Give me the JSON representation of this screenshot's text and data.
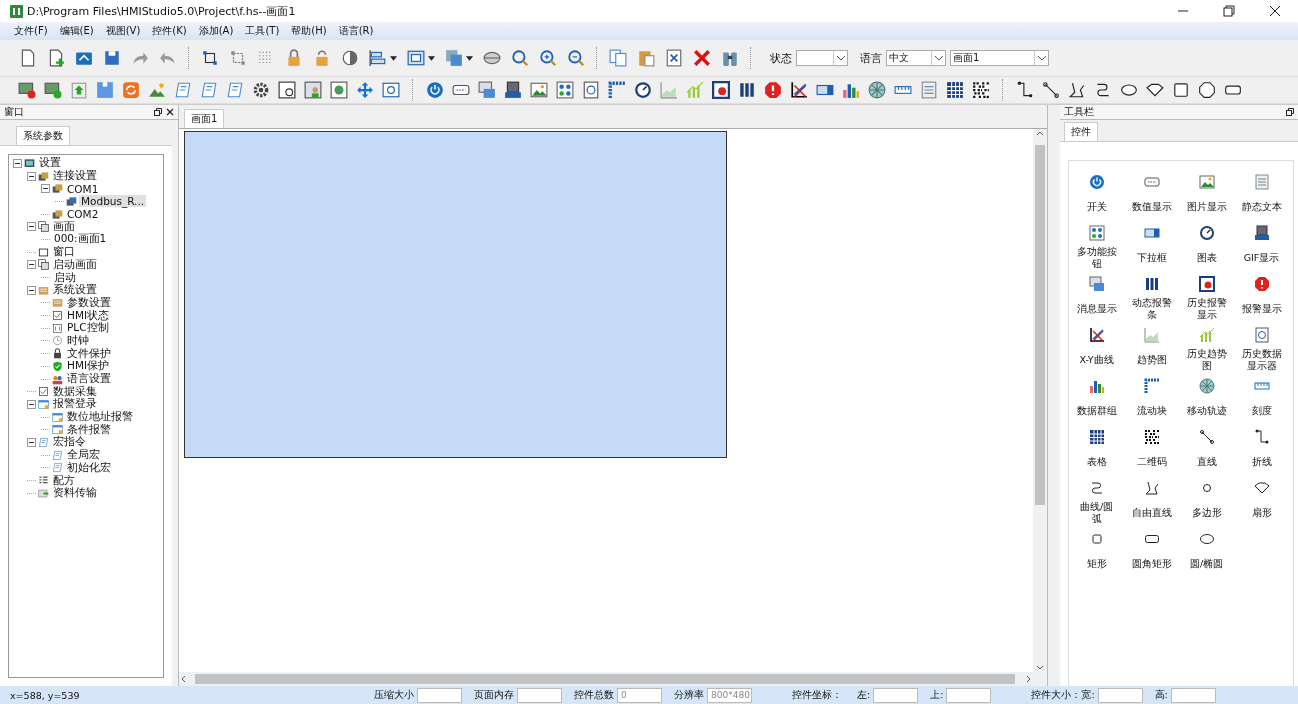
{
  "window": {
    "title": "D:\\Program Files\\HMIStudio5.0\\Project\\f.hs--画面1"
  },
  "menu": [
    {
      "label": "文件(F)"
    },
    {
      "label": "编辑(E)"
    },
    {
      "label": "视图(V)"
    },
    {
      "label": "控件(K)"
    },
    {
      "label": "添加(A)"
    },
    {
      "label": "工具(T)"
    },
    {
      "label": "帮助(H)"
    },
    {
      "label": "语言(R)"
    }
  ],
  "toolbar": {
    "fields": [
      {
        "label": "状态",
        "kind": "combo"
      },
      {
        "label": "语言",
        "kind": "combo",
        "value": "中文"
      },
      {
        "kind": "combo",
        "value": "画面1"
      }
    ]
  },
  "left_panel": {
    "title": "窗口",
    "tabs": [
      {
        "label": "系统参数",
        "selected": true
      }
    ],
    "tree": [
      {
        "label": "设置",
        "kind": "node",
        "expanded": true,
        "selected": false,
        "children": [
          {
            "label": "连接设置",
            "kind": "node",
            "expanded": true,
            "selected": false,
            "children": [
              {
                "label": "COM1",
                "kind": "node",
                "expanded": true,
                "selected": false,
                "children": [
                  {
                    "label": "Modbus_R...",
                    "kind": "node",
                    "selected": true
                  }
                ]
              },
              {
                "label": "COM2",
                "kind": "node",
                "selected": false
              }
            ]
          },
          {
            "label": "画面",
            "kind": "node",
            "expanded": true,
            "selected": false,
            "children": [
              {
                "label": "000:画面1",
                "kind": "text",
                "selected": false
              }
            ]
          },
          {
            "label": "窗口",
            "kind": "node",
            "selected": false
          },
          {
            "label": "启动画面",
            "kind": "node",
            "expanded": true,
            "selected": false,
            "children": [
              {
                "label": "启动",
                "kind": "text",
                "selected": false
              }
            ]
          },
          {
            "label": "系统设置",
            "kind": "node",
            "expanded": true,
            "selected": false,
            "children": [
              {
                "label": "参数设置",
                "kind": "node",
                "selected": false
              },
              {
                "label": "HMI状态",
                "kind": "node",
                "selected": false
              },
              {
                "label": "PLC控制",
                "kind": "node",
                "selected": false
              },
              {
                "label": "时钟",
                "kind": "node",
                "selected": false
              },
              {
                "label": "文件保护",
                "kind": "node",
                "selected": false
              },
              {
                "label": "HMI保护",
                "kind": "node",
                "selected": false
              },
              {
                "label": "语言设置",
                "kind": "node",
                "selected": false
              }
            ]
          },
          {
            "label": "数据采集",
            "kind": "node",
            "selected": false
          },
          {
            "label": "报警登录",
            "kind": "node",
            "expanded": true,
            "selected": false,
            "children": [
              {
                "label": "数位地址报警",
                "kind": "node",
                "selected": false
              },
              {
                "label": "条件报警",
                "kind": "node",
                "selected": false
              }
            ]
          },
          {
            "label": "宏指令",
            "kind": "node",
            "expanded": true,
            "selected": false,
            "children": [
              {
                "label": "全局宏",
                "kind": "node",
                "selected": false
              },
              {
                "label": "初始化宏",
                "kind": "node",
                "selected": false
              }
            ]
          },
          {
            "label": "配方",
            "kind": "node",
            "selected": false
          },
          {
            "label": "资料传输",
            "kind": "node",
            "selected": false
          }
        ]
      }
    ]
  },
  "editor": {
    "tabs": [
      {
        "label": "画面1",
        "selected": true
      }
    ]
  },
  "right_panel": {
    "title": "工具栏",
    "tabs": [
      {
        "label": "控件",
        "selected": true
      }
    ],
    "controls": [
      {
        "label": "开关"
      },
      {
        "label": "数值显示"
      },
      {
        "label": "图片显示"
      },
      {
        "label": "静态文本"
      },
      {
        "label": "多功能按钮"
      },
      {
        "label": "下拉框"
      },
      {
        "label": "图表"
      },
      {
        "label": "GIF显示"
      },
      {
        "label": "消息显示"
      },
      {
        "label": "动态报警条"
      },
      {
        "label": "历史报警显示"
      },
      {
        "label": "报警显示"
      },
      {
        "label": "X-Y曲线"
      },
      {
        "label": "趋势图"
      },
      {
        "label": "历史趋势图"
      },
      {
        "label": "历史数据显示器"
      },
      {
        "label": "数据群组"
      },
      {
        "label": "流动块"
      },
      {
        "label": "移动轨迹"
      },
      {
        "label": "刻度"
      },
      {
        "label": "表格"
      },
      {
        "label": "二维码"
      },
      {
        "label": "直线"
      },
      {
        "label": "折线"
      },
      {
        "label": "曲线/圆弧"
      },
      {
        "label": "自由直线"
      },
      {
        "label": "多边形"
      },
      {
        "label": "扇形"
      },
      {
        "label": "矩形"
      },
      {
        "label": "圆角矩形"
      },
      {
        "label": "圆/椭圆"
      }
    ]
  },
  "status_bar": {
    "cursor": "x=588, y=539",
    "fields": [
      {
        "label": "压缩大小"
      },
      {
        "label": "页面内存"
      },
      {
        "label": "控件总数",
        "value": "0"
      },
      {
        "label": "分辨率",
        "value": "800*480"
      },
      {
        "group": "控件坐标：",
        "label": "左:"
      },
      {
        "label": "上:"
      },
      {
        "group": "控件大小：宽:"
      },
      {
        "label": "高:"
      }
    ]
  }
}
